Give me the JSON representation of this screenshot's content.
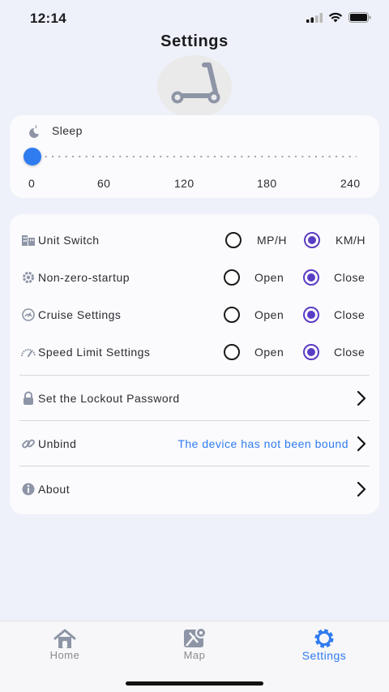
{
  "status_bar": {
    "time": "12:14"
  },
  "header": {
    "title": "Settings"
  },
  "sleep": {
    "label": "Sleep",
    "value": 0,
    "min": 0,
    "max": 240,
    "ticks": [
      "0",
      "60",
      "120",
      "180",
      "240"
    ]
  },
  "settings": {
    "unit_switch": {
      "label": "Unit Switch",
      "option_a": "MP/H",
      "option_b": "KM/H",
      "selected": "KM/H"
    },
    "non_zero_startup": {
      "label": "Non-zero-startup",
      "option_a": "Open",
      "option_b": "Close",
      "selected": "Close"
    },
    "cruise": {
      "label": "Cruise Settings",
      "option_a": "Open",
      "option_b": "Close",
      "selected": "Close"
    },
    "speed_limit": {
      "label": "Speed Limit Settings",
      "option_a": "Open",
      "option_b": "Close",
      "selected": "Close"
    },
    "lockout": {
      "label": "Set the Lockout Password"
    },
    "unbind": {
      "label": "Unbind",
      "status": "The device has not been bound"
    },
    "about": {
      "label": "About"
    }
  },
  "tabs": [
    {
      "label": "Home",
      "icon": "home-icon",
      "active": false
    },
    {
      "label": "Map",
      "icon": "map-icon",
      "active": false
    },
    {
      "label": "Settings",
      "icon": "gear-icon",
      "active": true
    }
  ],
  "colors": {
    "accent": "#2f7bf0",
    "radio_selected": "#5b3cc4",
    "background": "#eef1f9"
  }
}
